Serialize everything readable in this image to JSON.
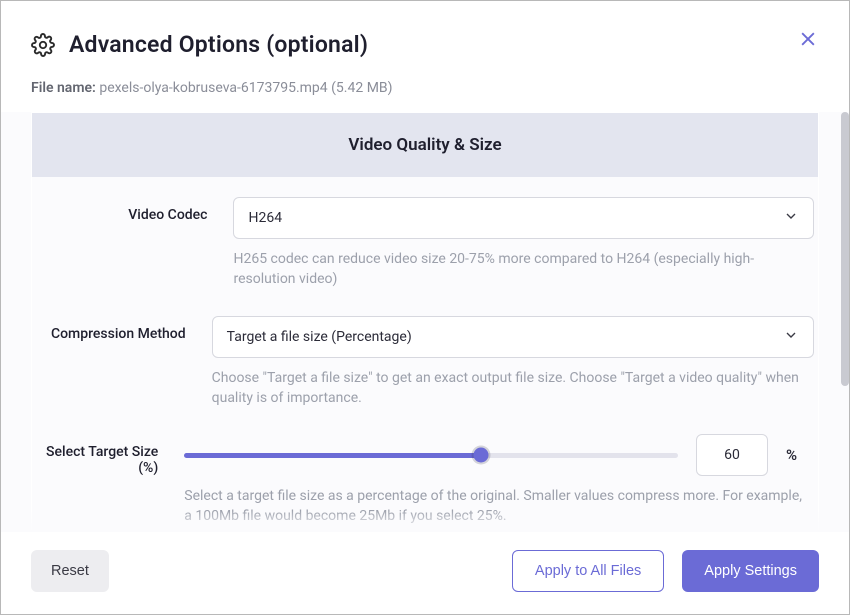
{
  "header": {
    "title": "Advanced Options (optional)"
  },
  "file": {
    "label": "File name:",
    "name": "pexels-olya-kobruseva-6173795.mp4",
    "size": "(5.42 MB)"
  },
  "section": {
    "title": "Video Quality & Size",
    "codec": {
      "label": "Video Codec",
      "value": "H264",
      "help": "H265 codec can reduce video size 20-75% more compared to H264 (especially high-resolution video)"
    },
    "compression": {
      "label": "Compression Method",
      "value": "Target a file size (Percentage)",
      "help": "Choose \"Target a file size\" to get an exact output file size. Choose \"Target a video quality\" when quality is of importance."
    },
    "target": {
      "label": "Select Target Size (%)",
      "value": "60",
      "unit": "%",
      "help": "Select a target file size as a percentage of the original. Smaller values compress more. For example, a 100Mb file would become 25Mb if you select 25%."
    }
  },
  "footer": {
    "reset": "Reset",
    "applyAll": "Apply to All Files",
    "apply": "Apply Settings"
  }
}
